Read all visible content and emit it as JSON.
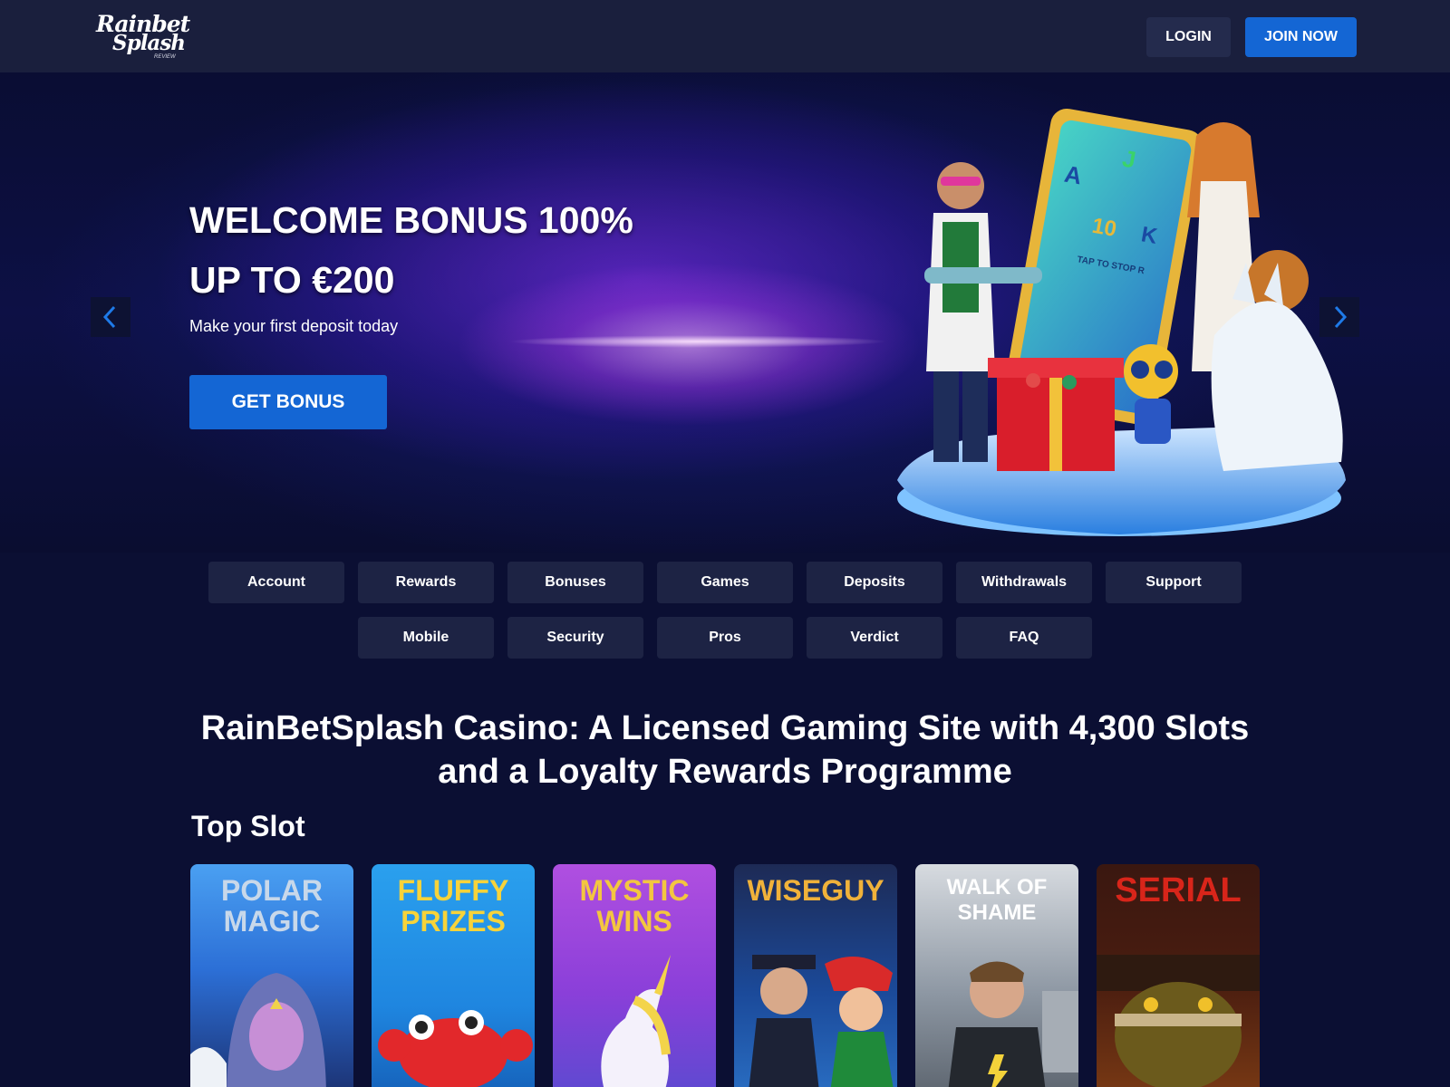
{
  "header": {
    "logo": {
      "line1": "Rainbet",
      "line2": "Splash",
      "line3": "REVIEW"
    },
    "login_label": "LOGIN",
    "join_label": "JOIN NOW"
  },
  "hero": {
    "title_line1": "WELCOME BONUS 100%",
    "title_line2": "UP TO €200",
    "subtitle": "Make your first deposit today",
    "button_label": "GET BONUS",
    "phone_reels": [
      "A",
      "J",
      "10",
      "K"
    ],
    "phone_banner": "TAP TO STOP R"
  },
  "nav": {
    "row1": [
      "Account",
      "Rewards",
      "Bonuses",
      "Games",
      "Deposits",
      "Withdrawals",
      "Support"
    ],
    "row2": [
      "Mobile",
      "Security",
      "Pros",
      "Verdict",
      "FAQ"
    ]
  },
  "main": {
    "heading": "RainBetSplash Casino: A Licensed Gaming Site with 4,300 Slots and a Loyalty Rewards Programme",
    "section_title": "Top Slot"
  },
  "slots": [
    {
      "name": "POLAR MAGIC",
      "line1": "POLAR",
      "line2": "MAGIC",
      "bg": "#2c6fd6",
      "text": "#c8d8ea"
    },
    {
      "name": "FLUFFY PRIZES",
      "line1": "FLUFFY",
      "line2": "PRIZES",
      "bg": "#1f86e0",
      "text": "#f7d33a"
    },
    {
      "name": "MYSTIC WINS",
      "line1": "MYSTIC",
      "line2": "WINS",
      "bg": "#8a3fd9",
      "text": "#f3c640"
    },
    {
      "name": "WISEGUY",
      "line1": "WISEGUY",
      "line2": "",
      "bg": "#1b4a9a",
      "text": "#f0b23a"
    },
    {
      "name": "WALK OF SHAME",
      "line1": "WALK OF",
      "line2": "SHAME",
      "bg": "#6f7d8e",
      "text": "#ffffff"
    },
    {
      "name": "SERIAL",
      "line1": "SERIAL",
      "line2": "",
      "bg": "#4a1d10",
      "text": "#d8251a"
    }
  ],
  "colors": {
    "page_bg": "#0b0f33",
    "header_bg": "#1a1f3d",
    "accent": "#1466d4",
    "pill_bg": "#1d2344"
  },
  "icons": [
    "chevron-left-icon",
    "chevron-right-icon"
  ]
}
